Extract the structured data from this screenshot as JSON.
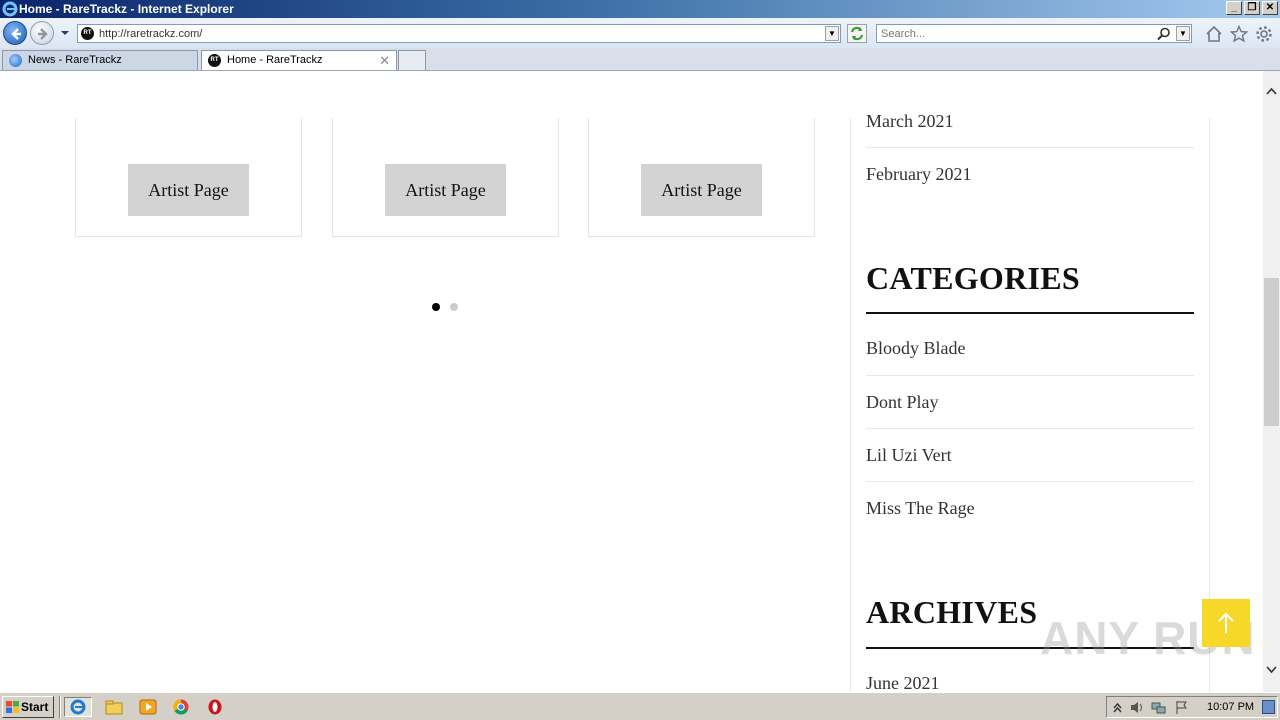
{
  "window": {
    "title": "Home - RareTrackz - Internet Explorer"
  },
  "address_bar": {
    "url": "http://raretrackz.com/",
    "favicon_text": "RT"
  },
  "search": {
    "placeholder": "Search..."
  },
  "tabs": [
    {
      "label": "News - RareTrackz",
      "active": false
    },
    {
      "label": "Home - RareTrackz",
      "active": true
    }
  ],
  "content": {
    "artist_buttons": [
      "Artist Page",
      "Artist Page",
      "Artist Page"
    ],
    "carousel": {
      "pages": 2,
      "active_index": 0
    }
  },
  "sidebar": {
    "archive_top": [
      "March 2021",
      "February 2021"
    ],
    "categories_heading": "CATEGORIES",
    "categories": [
      "Bloody Blade",
      "Dont Play",
      "Lil Uzi Vert",
      "Miss The Rage"
    ],
    "archives_heading": "ARCHIVES",
    "archives": [
      "June 2021"
    ]
  },
  "watermark": "ANY RUN",
  "taskbar": {
    "start_label": "Start",
    "clock": "10:07 PM"
  },
  "colors": {
    "scroll_top_button": "#f5d82a",
    "titlebar_start": "#0a246a",
    "titlebar_end": "#a6caf0"
  },
  "icons": [
    "ie-icon",
    "back-arrow-icon",
    "forward-arrow-icon",
    "refresh-icon",
    "search-icon",
    "home-icon",
    "star-icon",
    "gear-icon",
    "arrow-up-icon"
  ]
}
